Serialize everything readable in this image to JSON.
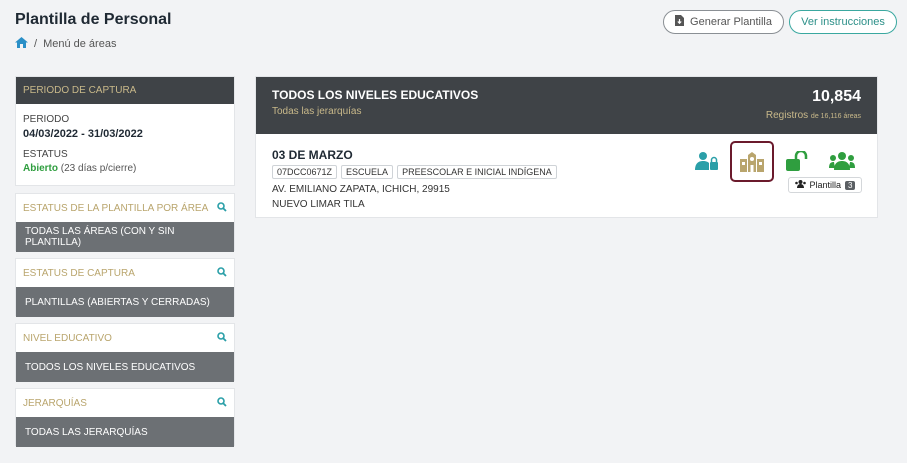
{
  "header": {
    "title": "Plantilla de Personal",
    "breadcrumb_sep": "/",
    "breadcrumb_item": "Menú de áreas",
    "btn_generar": "Generar Plantilla",
    "btn_ver": "Ver instrucciones"
  },
  "periodo": {
    "heading": "PERIODO DE CAPTURA",
    "label": "PERIODO",
    "range": "04/03/2022 - 31/03/2022",
    "status_label": "ESTATUS",
    "status_value": "Abierto",
    "status_note": "(23 días p/cierre)"
  },
  "filters": [
    {
      "title": "ESTATUS DE LA PLANTILLA POR ÁREA",
      "value": "TODAS LAS ÁREAS (CON Y SIN PLANTILLA)"
    },
    {
      "title": "ESTATUS DE CAPTURA",
      "value": "PLANTILLAS (ABIERTAS Y CERRADAS)"
    },
    {
      "title": "NIVEL EDUCATIVO",
      "value": "TODOS LOS NIVELES EDUCATIVOS"
    },
    {
      "title": "JERARQUÍAS",
      "value": "TODAS LAS JERARQUÍAS"
    }
  ],
  "main": {
    "title": "TODOS LOS NIVELES EDUCATIVOS",
    "subtitle": "Todas las jerarquías",
    "count": "10,854",
    "registros": "Registros",
    "registros_note": "de 16,116 áreas"
  },
  "item": {
    "name": "03 DE MARZO",
    "tags": [
      "07DCC0671Z",
      "ESCUELA",
      "PREESCOLAR E INICIAL INDÍGENA"
    ],
    "address1": "AV. EMILIANO ZAPATA, ICHICH, 29915",
    "address2": "NUEVO LIMAR TILA",
    "plantilla_label": "Plantilla",
    "plantilla_count": "3"
  },
  "colors": {
    "accent_teal": "#2a9fa8",
    "open_green": "#2f9e3f",
    "gold": "#b9a56d",
    "dark_header": "#3f4347",
    "highlight_border": "#6b1a2c"
  }
}
